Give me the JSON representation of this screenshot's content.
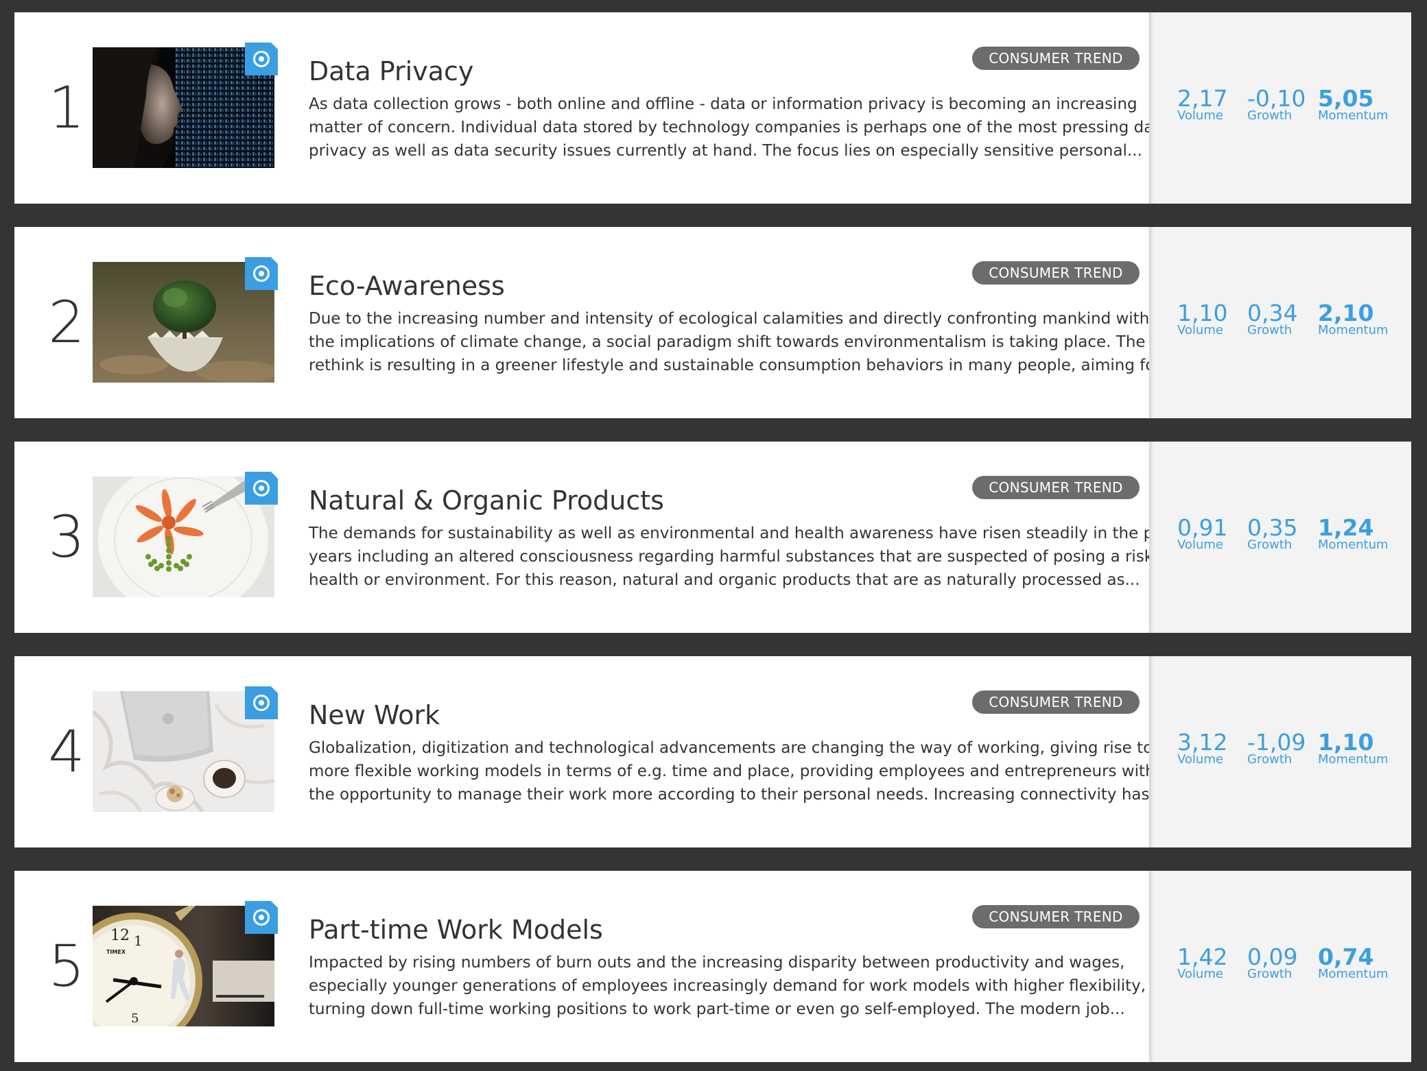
{
  "metric_labels": {
    "volume": "Volume",
    "growth": "Growth",
    "momentum": "Momentum"
  },
  "colors": {
    "accent": "#3b9ee2",
    "tag": "#6c6c6c",
    "background": "#343434"
  },
  "trends": [
    {
      "rank": "1",
      "title": "Data Privacy",
      "tag": "CONSUMER TREND",
      "image": "woman-binary-code-image",
      "description": [
        "As data collection grows - both online and offline - data or information privacy is becoming an increasing",
        "matter of concern. Individual data stored by technology companies is perhaps one of the most pressing data",
        "privacy as well as data security issues currently at hand. The focus lies on especially sensitive personal..."
      ],
      "volume": "2,17",
      "growth": "-0,10",
      "momentum": "5,05"
    },
    {
      "rank": "2",
      "title": "Eco-Awareness",
      "tag": "CONSUMER TREND",
      "image": "tree-in-eggshell-image",
      "description": [
        "Due to the increasing number and intensity of ecological calamities and directly confronting mankind with",
        "the implications of climate change, a social paradigm shift towards environmentalism is taking place. The",
        "rethink is resulting in a greener lifestyle and sustainable consumption behaviors in many people, aiming for..."
      ],
      "volume": "1,10",
      "growth": "0,34",
      "momentum": "2,10"
    },
    {
      "rank": "3",
      "title": "Natural & Organic Products",
      "tag": "CONSUMER TREND",
      "image": "vegetable-flower-plate-image",
      "description": [
        "The demands for sustainability as well as environmental and health awareness have risen steadily in the past",
        "years including an altered consciousness regarding harmful substances that are suspected of posing a risk to",
        "health or environment. For this reason, natural and organic products that are as naturally processed as..."
      ],
      "volume": "0,91",
      "growth": "0,35",
      "momentum": "1,24"
    },
    {
      "rank": "4",
      "title": "New Work",
      "tag": "CONSUMER TREND",
      "image": "laptop-on-bed-image",
      "description": [
        "Globalization, digitization and technological advancements are changing the way of working, giving rise to",
        "more flexible working models in terms of e.g. time and place, providing employees and entrepreneurs with",
        "the opportunity to manage their work more according to their personal needs. Increasing connectivity has..."
      ],
      "volume": "3,12",
      "growth": "-1,09",
      "momentum": "1,10"
    },
    {
      "rank": "5",
      "title": "Part-time Work Models",
      "tag": "CONSUMER TREND",
      "image": "alarm-clock-image",
      "clock_brand": "TIMEX",
      "clock_numbers": [
        "12",
        "1",
        "5"
      ],
      "description": [
        "Impacted by rising numbers of burn outs and the increasing disparity between productivity and wages,",
        "especially younger generations of employees increasingly demand for work models with higher flexibility,",
        "turning down full-time working positions to work part-time or even go self-employed. The modern job..."
      ],
      "volume": "1,42",
      "growth": "0,09",
      "momentum": "0,74"
    }
  ]
}
